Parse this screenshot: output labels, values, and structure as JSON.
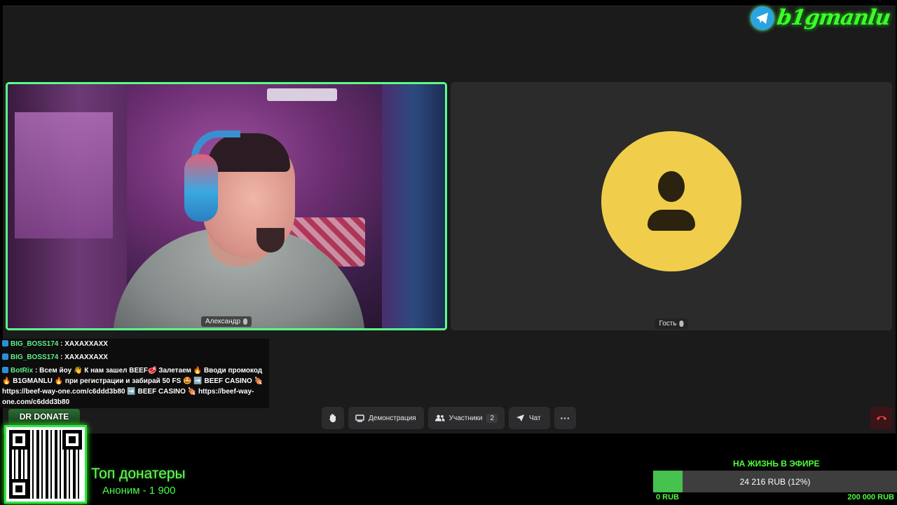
{
  "logo": {
    "text": "b1gmanlu",
    "icon": "telegram-icon"
  },
  "participants": {
    "left": {
      "name": "Александр",
      "mic_icon": "mic-icon"
    },
    "right": {
      "name": "Гость",
      "mic_icon": "mic-icon",
      "avatar_icon": "user-icon",
      "avatar_color": "#f0ce4b"
    }
  },
  "chat": [
    {
      "user": "BIG_BOSS174",
      "sep": " : ",
      "text": "ХАХАХХАХХ"
    },
    {
      "user": "BIG_BOSS174",
      "sep": " : ",
      "text": "ХАХАХХАХХ"
    },
    {
      "user": "BotRix",
      "sep": " : ",
      "text": "Всем йоу 👋 К нам зашел BEEF🥩 Залетаем 🔥 Вводи промокод 🔥 B1GMANLU 🔥 при регистрации и забирай 50 FS 🤩 ➡️ BEEF CASINO 🍖 https://beef-way-one.com/c6ddd3b80 ➡️ BEEF CASINO 🍖 https://beef-way-one.com/c6ddd3b80"
    }
  ],
  "toolbar": {
    "raise_hand_icon": "hand-icon",
    "demo_label": "Демонстрация",
    "participants_label": "Участники",
    "participants_count": "2",
    "chat_label": "Чат",
    "more_label": "···",
    "hangup_icon": "phone-hangup-icon"
  },
  "donate": {
    "button_label": "DR DONATE",
    "top_title": "Топ донатеры",
    "top_entry": "Аноним - 1 900"
  },
  "goal": {
    "title": "НА ЖИЗНЬ В ЭФИРЕ",
    "progress_text": "24 216 RUB (12%)",
    "progress_fraction": 0.12,
    "min_label": "0 RUB",
    "max_label": "200 000 RUB"
  },
  "colors": {
    "accent_green": "#4cff3a",
    "active_border": "#5bff8a",
    "chat_user": "#5ff08a",
    "hangup": "#ff4a4a"
  }
}
